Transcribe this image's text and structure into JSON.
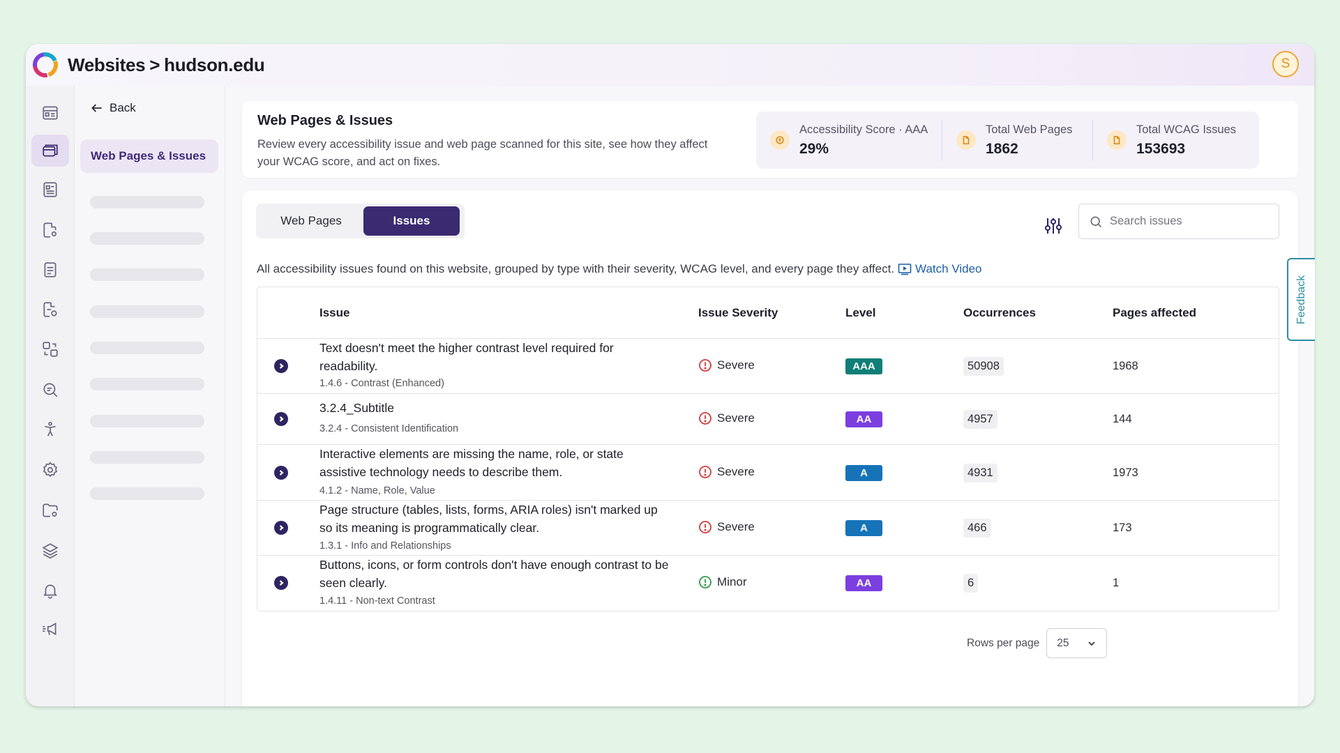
{
  "header": {
    "breadcrumb_root": "Websites",
    "breadcrumb_sep": ">",
    "breadcrumb_site": "hudson.edu",
    "avatar_initial": "S"
  },
  "subnav": {
    "back_label": "Back",
    "active_item": "Web Pages & Issues"
  },
  "summary": {
    "title": "Web Pages & Issues",
    "description": "Review every accessibility issue and web page scanned for this site, see how they affect your WCAG score, and act on fixes.",
    "stats": [
      {
        "label": "Accessibility Score · AAA",
        "value": "29%",
        "icon": "score-icon"
      },
      {
        "label": "Total Web Pages",
        "value": "1862",
        "icon": "file-icon"
      },
      {
        "label": "Total WCAG Issues",
        "value": "153693",
        "icon": "file-icon"
      }
    ]
  },
  "tabs": [
    "Web Pages",
    "Issues"
  ],
  "active_tab": "Issues",
  "search": {
    "placeholder": "Search issues"
  },
  "intro": {
    "text": "All accessibility issues found on this website, grouped by type with their severity, WCAG level, and every page they affect.",
    "link_label": "Watch Video"
  },
  "table": {
    "columns": [
      "Issue",
      "Issue Severity",
      "Level",
      "Occurrences",
      "Pages affected"
    ],
    "rows": [
      {
        "title": "Text doesn't meet the higher contrast level required for readability.",
        "criterion": "1.4.6 - Contrast (Enhanced)",
        "severity": "Severe",
        "level": "AAA",
        "occurrences": "50908",
        "pages": "1968"
      },
      {
        "title": "3.2.4_Subtitle",
        "criterion": "3.2.4 - Consistent Identification",
        "severity": "Severe",
        "level": "AA",
        "occurrences": "4957",
        "pages": "144"
      },
      {
        "title": "Interactive elements are missing the name, role, or state assistive technology needs to describe them.",
        "criterion": "4.1.2 - Name, Role, Value",
        "severity": "Severe",
        "level": "A",
        "occurrences": "4931",
        "pages": "1973"
      },
      {
        "title": "Page structure (tables, lists, forms, ARIA roles) isn't marked up so its meaning is programmatically clear.",
        "criterion": "1.3.1 - Info and Relationships",
        "severity": "Severe",
        "level": "A",
        "occurrences": "466",
        "pages": "173"
      },
      {
        "title": "Buttons, icons, or form controls don't have enough contrast to be seen clearly.",
        "criterion": "1.4.11 - Non-text Contrast",
        "severity": "Minor",
        "level": "AA",
        "occurrences": "6",
        "pages": "1"
      }
    ]
  },
  "pagination": {
    "rows_per_page_label": "Rows per page",
    "rows_per_page_value": "25"
  },
  "feedback_label": "Feedback",
  "colors": {
    "brand_primary": "#3a2a70",
    "level_AAA": "#0f7f78",
    "level_AA": "#7b3fe0",
    "level_A": "#1673b8",
    "severity_severe": "#d33b3b",
    "severity_minor": "#2f9a4a",
    "link": "#1d5fa8"
  }
}
